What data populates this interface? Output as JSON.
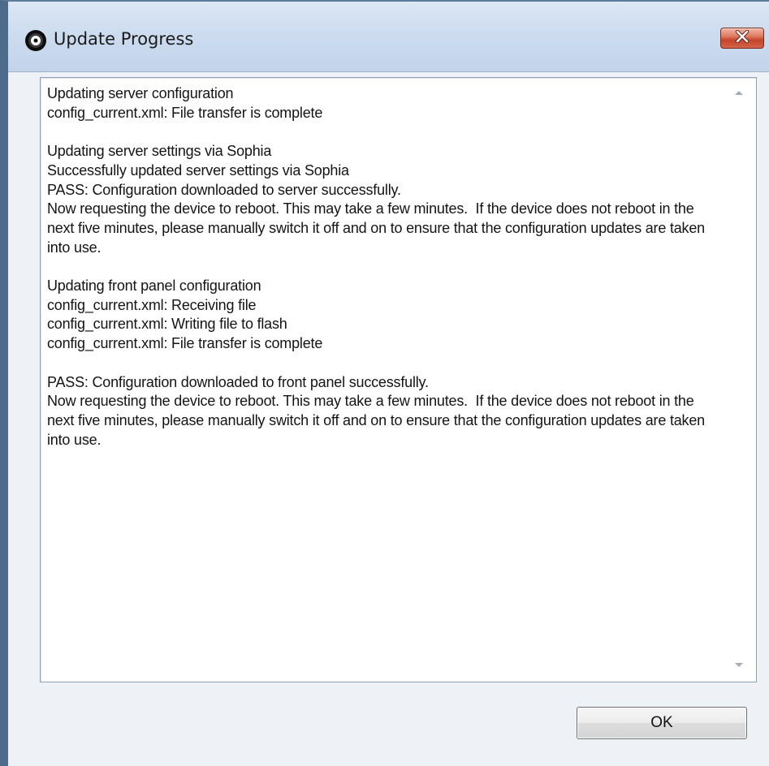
{
  "window": {
    "title": "Update Progress",
    "icon": "app-disc-icon"
  },
  "title_bar": {
    "close_icon": "close-icon",
    "close_color": "#c6452b"
  },
  "log": {
    "text": "Updating server configuration\nconfig_current.xml: File transfer is complete\n\nUpdating server settings via Sophia\nSuccessfully updated server settings via Sophia\nPASS: Configuration downloaded to server successfully.\nNow requesting the device to reboot. This may take a few minutes.  If the device does not reboot in the next five minutes, please manually switch it off and on to ensure that the configuration updates are taken into use.\n\nUpdating front panel configuration\nconfig_current.xml: Receiving file\nconfig_current.xml: Writing file to flash\nconfig_current.xml: File transfer is complete\n\nPASS: Configuration downloaded to front panel successfully.\nNow requesting the device to reboot. This may take a few minutes.  If the device does not reboot in the next five minutes, please manually switch it off and on to ensure that the configuration updates are taken into use."
  },
  "scrollbar": {
    "up_icon": "scroll-up-arrow-icon",
    "down_icon": "scroll-down-arrow-icon"
  },
  "buttons": {
    "ok_label": "OK"
  }
}
